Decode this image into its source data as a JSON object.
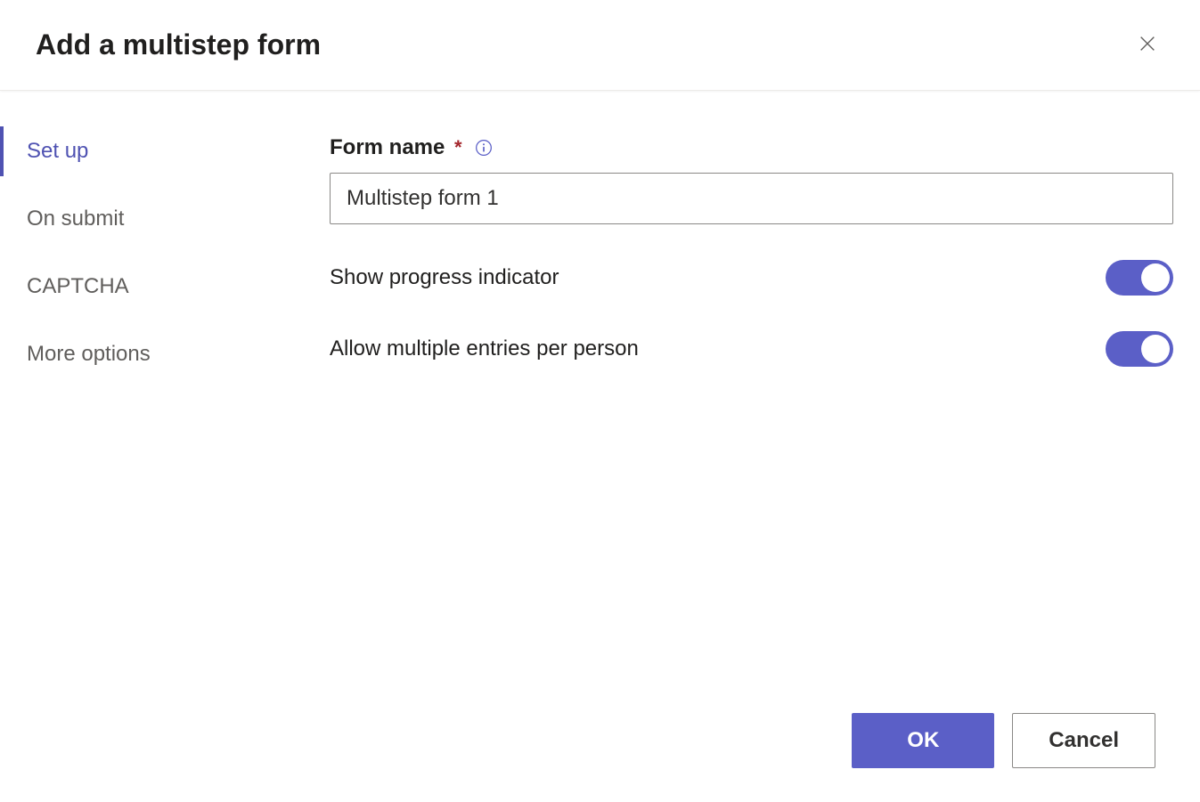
{
  "dialog": {
    "title": "Add a multistep form"
  },
  "sidebar": {
    "items": [
      {
        "label": "Set up",
        "active": true
      },
      {
        "label": "On submit",
        "active": false
      },
      {
        "label": "CAPTCHA",
        "active": false
      },
      {
        "label": "More options",
        "active": false
      }
    ]
  },
  "form": {
    "name_label": "Form name",
    "required_marker": "*",
    "name_value": "Multistep form 1",
    "progress_label": "Show progress indicator",
    "progress_on": true,
    "multiple_label": "Allow multiple entries per person",
    "multiple_on": true
  },
  "footer": {
    "ok_label": "OK",
    "cancel_label": "Cancel"
  }
}
